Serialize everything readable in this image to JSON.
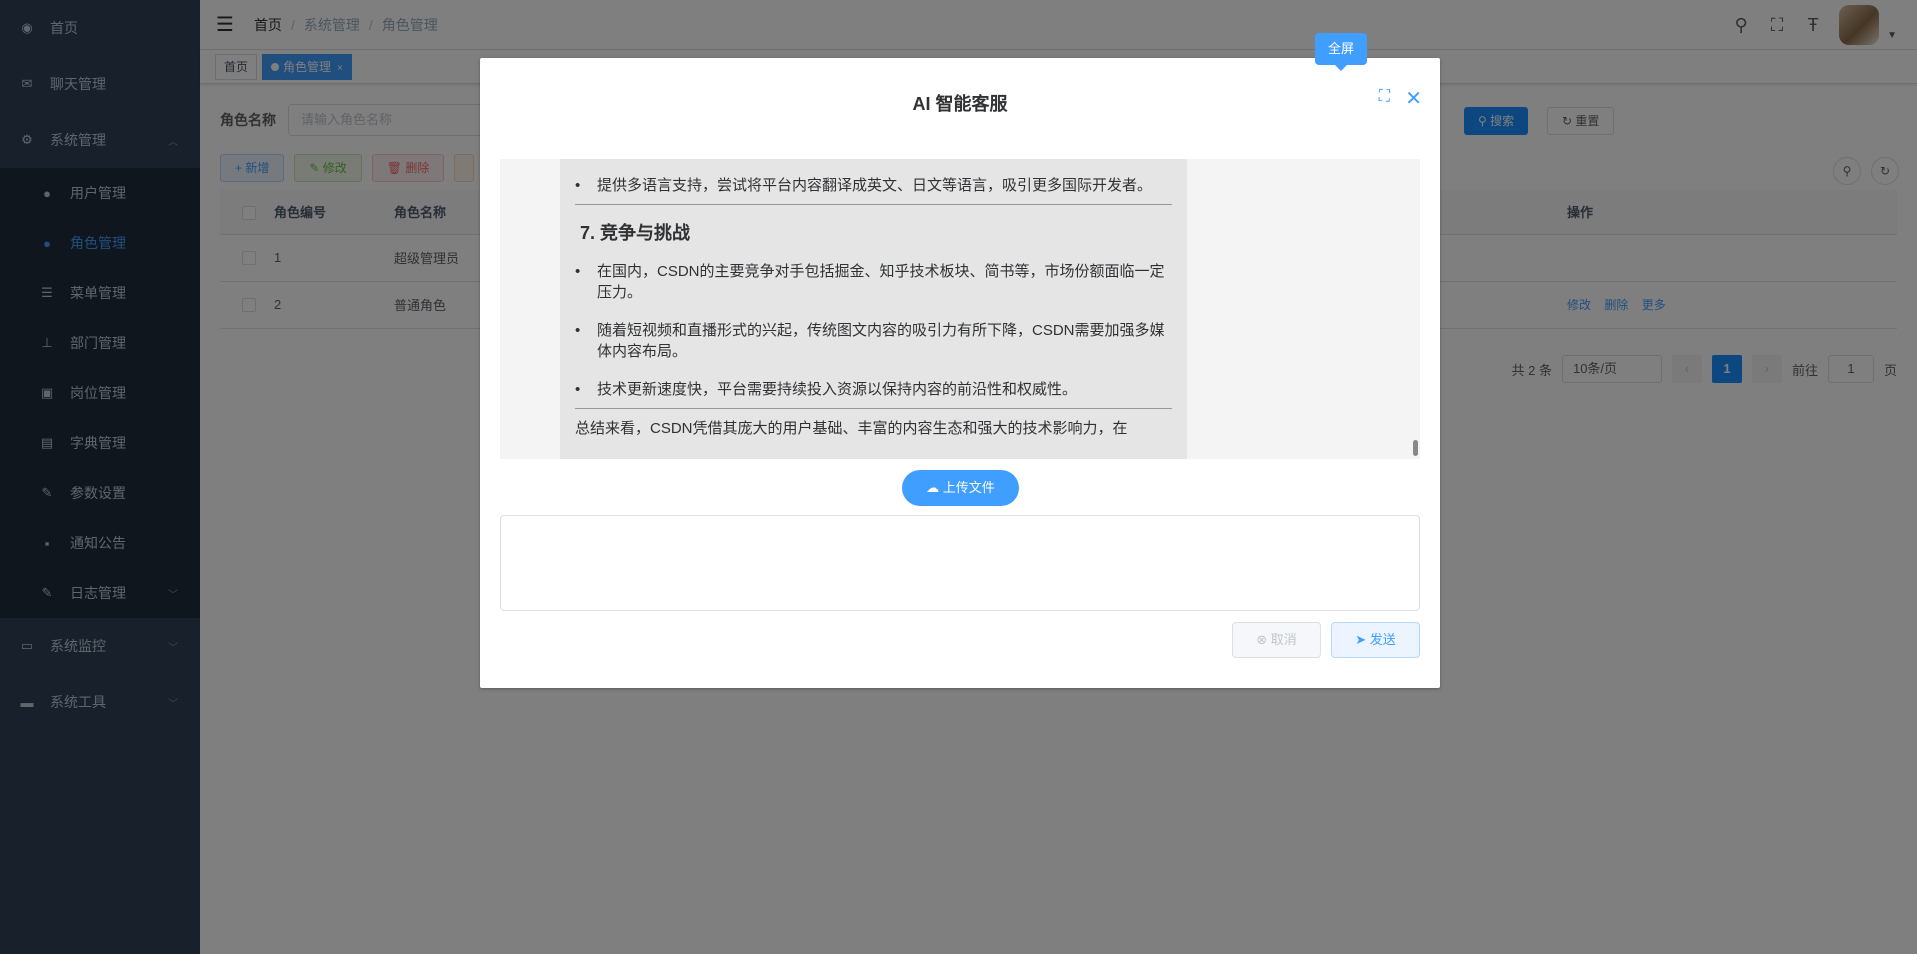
{
  "sidebar": {
    "items": [
      {
        "label": "首页",
        "icon": "dashboard-icon"
      },
      {
        "label": "聊天管理",
        "icon": "chat-icon"
      },
      {
        "label": "系统管理",
        "icon": "gear-icon"
      },
      {
        "label": "系统监控",
        "icon": "monitor-icon"
      },
      {
        "label": "系统工具",
        "icon": "toolbox-icon"
      }
    ],
    "submenu": [
      {
        "label": "用户管理",
        "icon": "user-icon"
      },
      {
        "label": "角色管理",
        "icon": "peoples-icon"
      },
      {
        "label": "菜单管理",
        "icon": "tree-table-icon"
      },
      {
        "label": "部门管理",
        "icon": "tree-icon"
      },
      {
        "label": "岗位管理",
        "icon": "post-icon"
      },
      {
        "label": "字典管理",
        "icon": "dict-icon"
      },
      {
        "label": "参数设置",
        "icon": "edit-icon"
      },
      {
        "label": "通知公告",
        "icon": "message-icon"
      },
      {
        "label": "日志管理",
        "icon": "log-icon"
      }
    ]
  },
  "navbar": {
    "breadcrumb": [
      "首页",
      "系统管理",
      "角色管理"
    ]
  },
  "tags": {
    "home": "首页",
    "active": "角色管理"
  },
  "search": {
    "label": "角色名称",
    "placeholder": "请输入角色名称",
    "search_btn": "搜索",
    "reset_btn": "重置"
  },
  "toolbar": {
    "add": "新增",
    "edit": "修改",
    "delete": "删除"
  },
  "table": {
    "headers": {
      "id": "角色编号",
      "name": "角色名称",
      "ops": "操作"
    },
    "rows": [
      {
        "id": "1",
        "name": "超级管理员"
      },
      {
        "id": "2",
        "name": "普通角色"
      }
    ],
    "row_ops": {
      "edit": "修改",
      "delete": "删除",
      "more": "更多"
    }
  },
  "pagination": {
    "total": "共 2 条",
    "page_size": "10条/页",
    "current": "1",
    "goto_label": "前往",
    "goto_value": "1",
    "page_suffix": "页"
  },
  "dialog": {
    "title": "AI 智能客服",
    "tooltip": "全屏",
    "chat": {
      "item_top": "提供多语言支持，尝试将平台内容翻译成英文、日文等语言，吸引更多国际开发者。",
      "heading": "7. 竞争与挑战",
      "items": [
        "在国内，CSDN的主要竞争对手包括掘金、知乎技术板块、简书等，市场份额面临一定压力。",
        "随着短视频和直播形式的兴起，传统图文内容的吸引力有所下降，CSDN需要加强多媒体内容布局。",
        "技术更新速度快，平台需要持续投入资源以保持内容的前沿性和权威性。"
      ],
      "summary": "总结来看，CSDN凭借其庞大的用户基础、丰富的内容生态和强大的技术影响力，在"
    },
    "upload_btn": "上传文件",
    "cancel_btn": "取消",
    "send_btn": "发送"
  },
  "colors": {
    "sidebar_bg": "#304156",
    "primary": "#409eff",
    "overlay": "rgba(0,0,0,0.5)"
  }
}
